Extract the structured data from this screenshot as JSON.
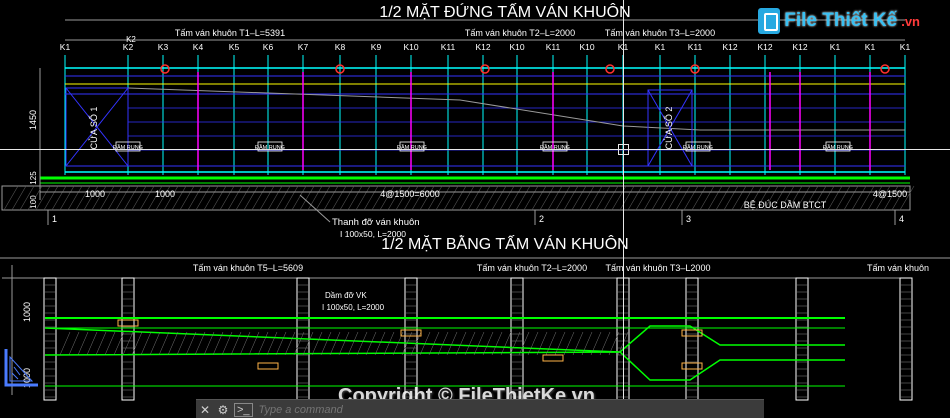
{
  "colors": {
    "background": "#000000",
    "title": "#ffffff",
    "label": "#ffffff",
    "magenta": "#ff00ff",
    "cyan": "#00ffff",
    "green": "#00ff00",
    "yellow": "#ffff00",
    "blue": "#3333ff",
    "red": "#ff3030",
    "grey": "#9a9a9a"
  },
  "elevation": {
    "title": "1/2 MẶT ĐỨNG TẤM VÁN KHUÔN",
    "panel_labels": [
      "Tấm ván khuôn T1–L=5391",
      "Tấm ván khuôn T2–L=2000",
      "Tấm ván khuôn T3–L=2000"
    ],
    "k_labels": [
      "K1",
      "K2",
      "K3",
      "K4",
      "K5",
      "K6",
      "K7",
      "K8",
      "K9",
      "K10",
      "K11",
      "K12",
      "K10",
      "K11",
      "K10",
      "K1",
      "K1",
      "K11",
      "K12",
      "K12",
      "K1"
    ],
    "k_label_top": "K1",
    "k_secondary": "K2",
    "window_labels": [
      "CỬA SỔ 1",
      "CỬA SỔ 2"
    ],
    "tag_label": "ĐẦM RUNG",
    "height_dims": [
      "1450",
      "125",
      "100"
    ],
    "bottom_dims": [
      "1000",
      "1000",
      "4@1500=6000",
      "4@1500"
    ],
    "axis_marks": [
      "1",
      "2",
      "3",
      "4"
    ],
    "support_note": "Thanh đỡ ván khuôn",
    "support_spec": "I 100x50, L=2000",
    "bed_label": "BỆ ĐÚC DẦM BTCT"
  },
  "plan": {
    "title": "1/2 MẶT BẰNG TẤM VÁN KHUÔN",
    "panel_labels": [
      "Tấm ván khuôn T5–L=5609",
      "Tấm ván khuôn T2–L=2000",
      "Tấm ván khuôn T3–L2000",
      "Tấm ván khuôn"
    ],
    "beam_note": "Dầm đỡ VK",
    "beam_spec": "I 100x50, L=2000",
    "side_dims": [
      "1000",
      "1000"
    ]
  },
  "watermark": {
    "logo_text": "File Thiết Kế",
    "logo_suffix": ".vn",
    "copyright": "Copyright © FileThietKe.vn"
  },
  "command_line": {
    "placeholder": "Type a command",
    "icons": [
      "close-icon",
      "wrench-icon",
      "command-prompt-icon"
    ]
  }
}
